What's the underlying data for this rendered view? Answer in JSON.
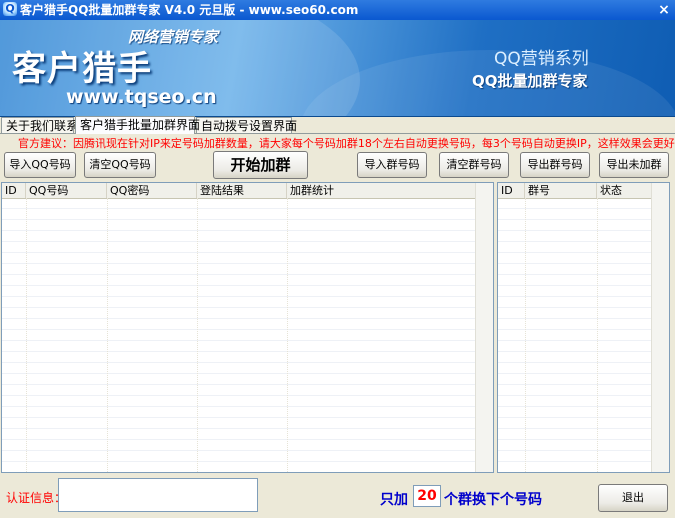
{
  "window": {
    "title": "客户猎手QQ批量加群专家 V4.0 元旦版 - www.seo60.com",
    "close_glyph": "×"
  },
  "banner": {
    "subtitle": "网络营销专家",
    "brand": "客户猎手",
    "url": "www.tqseo.cn",
    "series": "QQ营销系列",
    "product": "QQ批量加群专家"
  },
  "tabs": [
    {
      "label": "关于我们联系"
    },
    {
      "label": "客户猎手批量加群界面"
    },
    {
      "label": "自动拨号设置界面"
    }
  ],
  "advice": "官方建议：因腾讯现在针对IP来定号码加群数量，请大家每个号码加群18个左右自动更换号码，每3个号码自动更换IP，这样效果会更好！",
  "toolbar": {
    "import_qq": "导入QQ号码",
    "clear_qq": "清空QQ号码",
    "start": "开始加群",
    "import_group": "导入群号码",
    "clear_group": "清空群号码",
    "export_group": "导出群号码",
    "export_unjoined": "导出未加群"
  },
  "left_table": {
    "columns": [
      "ID",
      "QQ号码",
      "QQ密码",
      "登陆结果",
      "加群统计"
    ]
  },
  "right_table": {
    "columns": [
      "ID",
      "群号",
      "状态"
    ]
  },
  "footer": {
    "auth_label": "认证信息：",
    "auth_value": "",
    "switch_prefix": "只加",
    "switch_count": "20",
    "switch_suffix": "个群换下个号码",
    "exit_label": "退出"
  }
}
